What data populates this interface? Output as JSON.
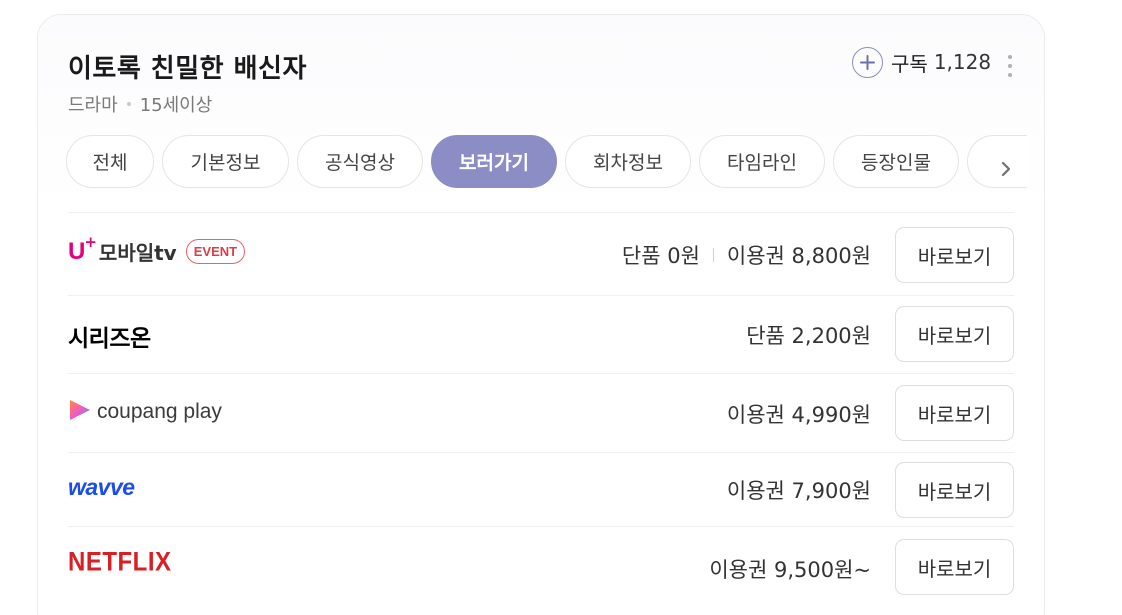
{
  "header": {
    "title": "이토록 친밀한 배신자",
    "genre": "드라마",
    "rating": "15세이상",
    "subscribe_label": "구독",
    "subscribe_count": "1,128"
  },
  "tabs": [
    {
      "label": "전체",
      "active": false
    },
    {
      "label": "기본정보",
      "active": false
    },
    {
      "label": "공식영상",
      "active": false
    },
    {
      "label": "보러가기",
      "active": true
    },
    {
      "label": "회차정보",
      "active": false
    },
    {
      "label": "타임라인",
      "active": false
    },
    {
      "label": "등장인물",
      "active": false
    }
  ],
  "providers": [
    {
      "logo_text": "모바일tv",
      "logo_u": "U",
      "logo_plus": "+",
      "badge": "EVENT",
      "price_single": "단품 0원",
      "price_pass": "이용권 8,800원",
      "button": "바로보기"
    },
    {
      "logo_text": "시리즈온",
      "price_pass": "단품 2,200원",
      "button": "바로보기"
    },
    {
      "logo_text": "coupang play",
      "price_pass": "이용권 4,990원",
      "button": "바로보기"
    },
    {
      "logo_text": "wavve",
      "price_pass": "이용권 7,900원",
      "button": "바로보기"
    },
    {
      "logo_text": "NETFLIX",
      "price_pass": "이용권 9,500원~",
      "button": "바로보기"
    }
  ],
  "colors": {
    "accent": "#8b8dc4",
    "uplus": "#e6007e",
    "wavve": "#1a4cf1",
    "netflix": "#d81f26",
    "event": "#e03c48"
  },
  "icons": [
    "plus-icon",
    "more-vertical-icon",
    "chevron-right-icon",
    "coupang-play-triangle-icon"
  ]
}
